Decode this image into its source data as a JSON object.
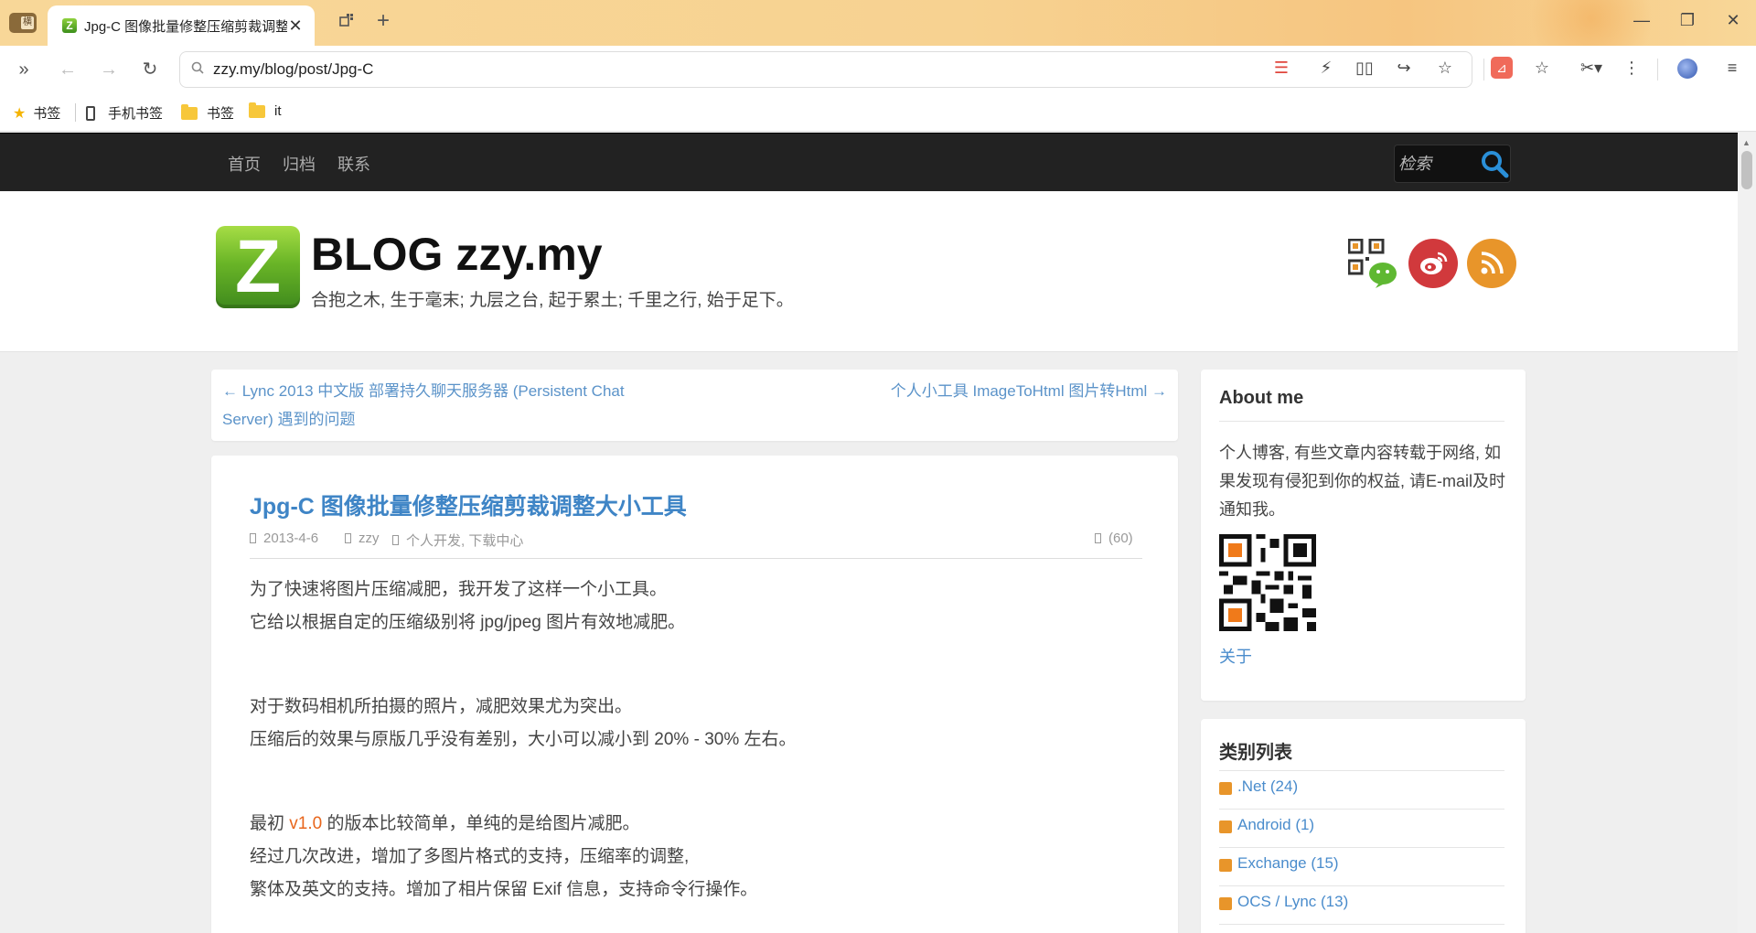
{
  "browser": {
    "side_button": "横",
    "tab": {
      "favicon": "Z",
      "title": "Jpg-C 图像批量修整压缩剪裁调整大小工具",
      "close": "✕"
    },
    "url": "zzy.my/blog/post/Jpg-C",
    "bookmarks": [
      {
        "label": "书签",
        "icon": "star-icon"
      },
      {
        "label": "手机书签",
        "icon": "phone-icon"
      },
      {
        "label": "书签",
        "icon": "folder-icon"
      },
      {
        "label": "it",
        "icon": "folder-icon"
      }
    ]
  },
  "site": {
    "nav": [
      "首页",
      "归档",
      "联系"
    ],
    "search_placeholder": "检索",
    "logo_letter": "Z",
    "title": "BLOG zzy.my",
    "tagline": "合抱之木, 生于毫末; 九层之台, 起于累土; 千里之行, 始于足下。"
  },
  "post_nav": {
    "prev": "← Lync 2013 中文版 部署持久聊天服务器 (Persistent Chat Server) 遇到的问题",
    "next": "个人小工具 ImageToHtml 图片转Html →"
  },
  "post": {
    "title": "Jpg-C 图像批量修整压缩剪裁调整大小工具",
    "date": "2013-4-6",
    "author": "zzy",
    "categories": "个人开发, 下载中心",
    "comments": "(60)",
    "p1": "为了快速将图片压缩减肥，我开发了这样一个小工具。",
    "p2": "它给以根据自定的压缩级别将 jpg/jpeg 图片有效地减肥。",
    "p3": "对于数码相机所拍摄的照片，减肥效果尤为突出。",
    "p4": "压缩后的效果与原版几乎没有差别，大小可以减小到 20% - 30% 左右。",
    "p5_pre": "最初 ",
    "p5_hl": "v1.0",
    "p5_post": " 的版本比较简单，单纯的是给图片减肥。",
    "p6": "经过几次改进，增加了多图片格式的支持，压缩率的调整,",
    "p7": "繁体及英文的支持。增加了相片保留 Exif 信息，支持命令行操作。"
  },
  "sidebar": {
    "about_title": "About me",
    "about_text": "个人博客, 有些文章内容转载于网络, 如果发现有侵犯到你的权益, 请E-mail及时通知我。",
    "about_link": "关于",
    "categories_title": "类别列表",
    "categories": [
      ".Net (24)",
      "Android (1)",
      "Exchange (15)",
      "OCS / Lync (13)"
    ]
  },
  "colors": {
    "nav_bg": "#222222",
    "link": "#4a8ccc",
    "highlight": "#e8661c",
    "logo_green": "#6ab527"
  }
}
